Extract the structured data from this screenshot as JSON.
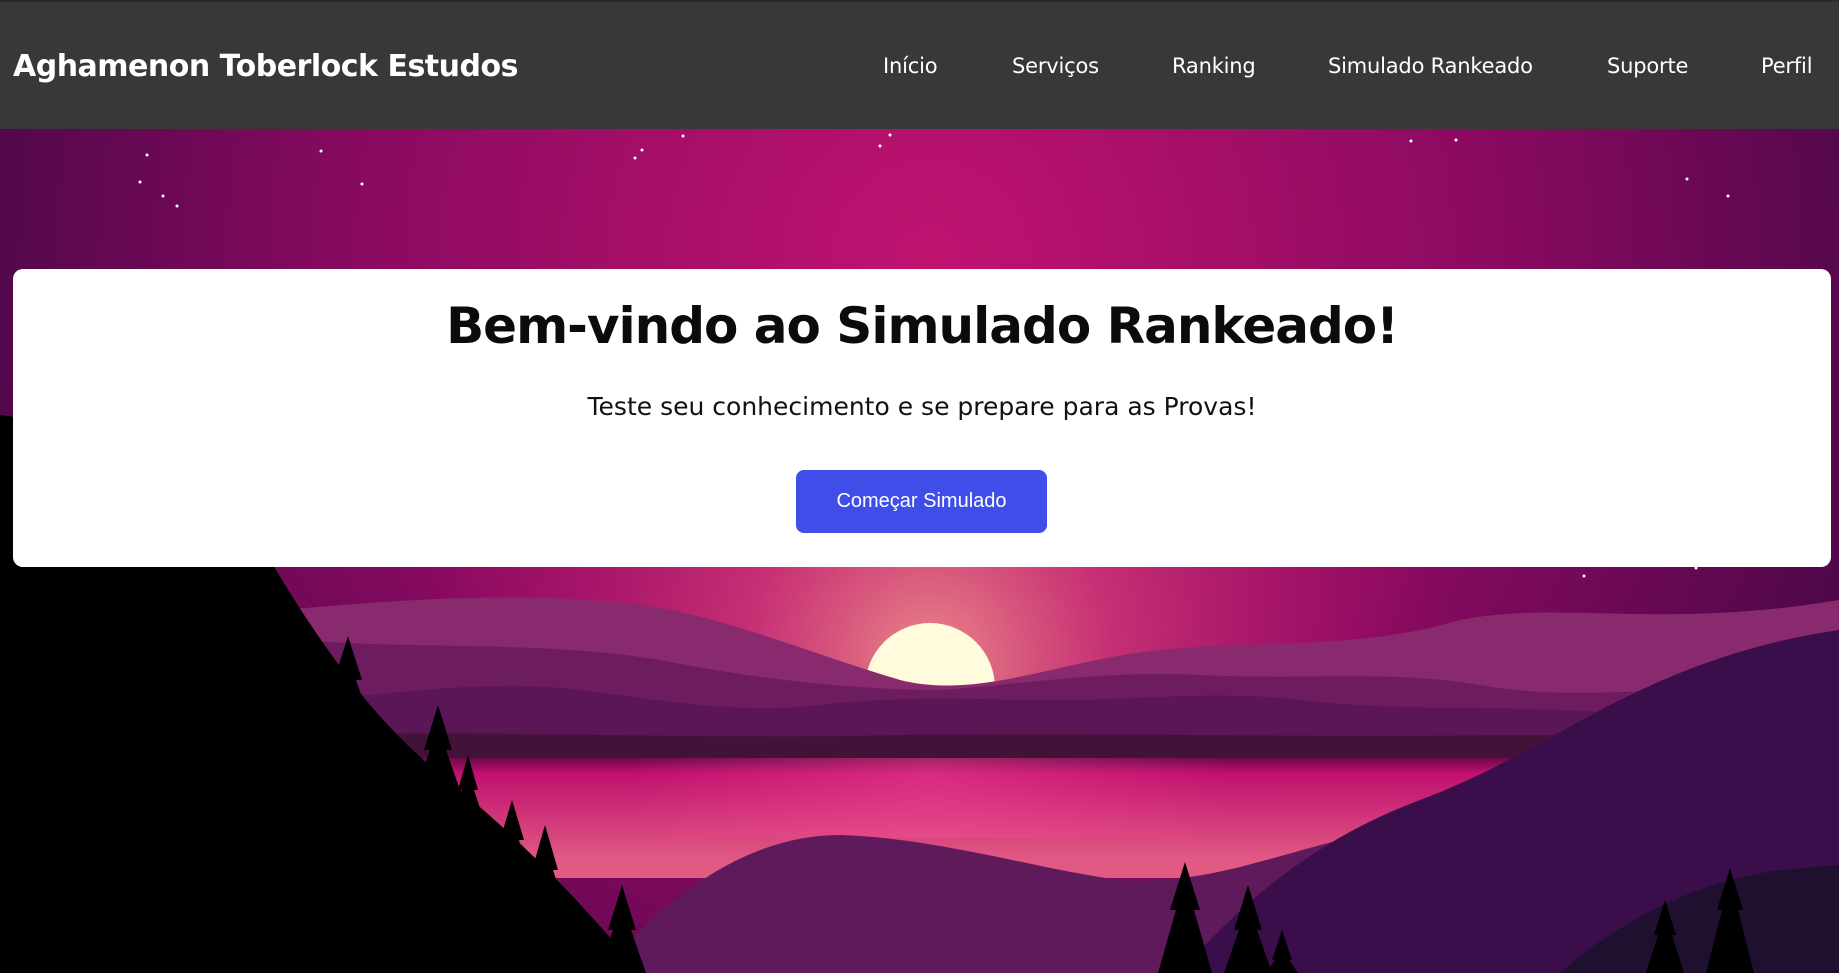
{
  "header": {
    "brand": "Aghamenon Toberlock Estudos",
    "nav": [
      {
        "label": "Início"
      },
      {
        "label": "Serviços"
      },
      {
        "label": "Ranking"
      },
      {
        "label": "Simulado Rankeado"
      },
      {
        "label": "Suporte"
      },
      {
        "label": "Perfil"
      }
    ]
  },
  "welcome": {
    "title": "Bem-vindo ao Simulado Rankeado!",
    "subtitle": "Teste seu conhecimento e se prepare para as Provas!",
    "button_label": "Começar Simulado"
  },
  "colors": {
    "navbar": "#383838",
    "button": "#3f4ee8",
    "card": "#ffffff",
    "sky_center": "#b8106a",
    "sky_edge": "#560850",
    "sun": "#fffbdc"
  }
}
